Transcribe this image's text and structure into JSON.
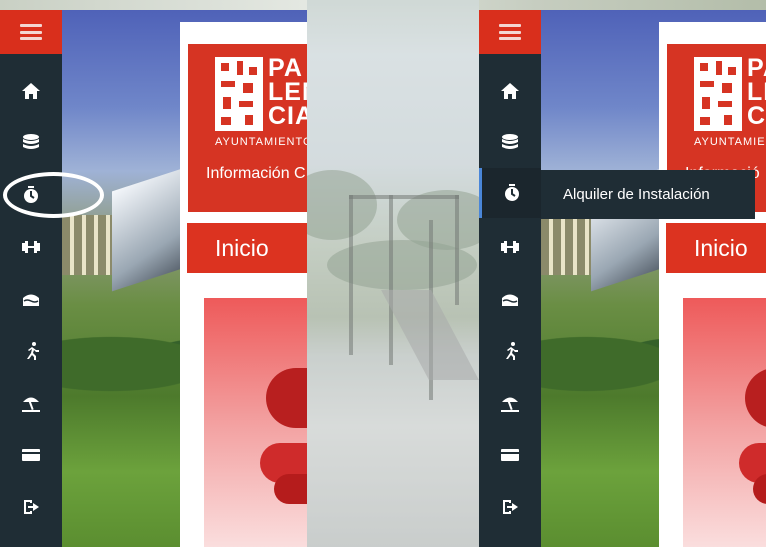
{
  "sidebar": {
    "menu_label": "Menu",
    "items": [
      {
        "icon": "home-icon"
      },
      {
        "icon": "database-icon"
      },
      {
        "icon": "stopwatch-icon"
      },
      {
        "icon": "dumbbell-icon"
      },
      {
        "icon": "pool-icon"
      },
      {
        "icon": "running-icon"
      },
      {
        "icon": "beach-umbrella-icon"
      },
      {
        "icon": "credit-card-icon"
      },
      {
        "icon": "logout-icon"
      }
    ]
  },
  "logo": {
    "line1": "PA",
    "line2": "LEN",
    "line3": "CIA",
    "subtitle": "AYUNTAMIENTO",
    "info_left": "Información C",
    "info_right": "Informació"
  },
  "main": {
    "section_title": "Inicio"
  },
  "tooltip": {
    "label": "Alquiler de Instalación"
  },
  "colors": {
    "accent_red": "#d92f1c",
    "sidebar_dark": "#1f2d35",
    "active_marker": "#4a86d8"
  }
}
